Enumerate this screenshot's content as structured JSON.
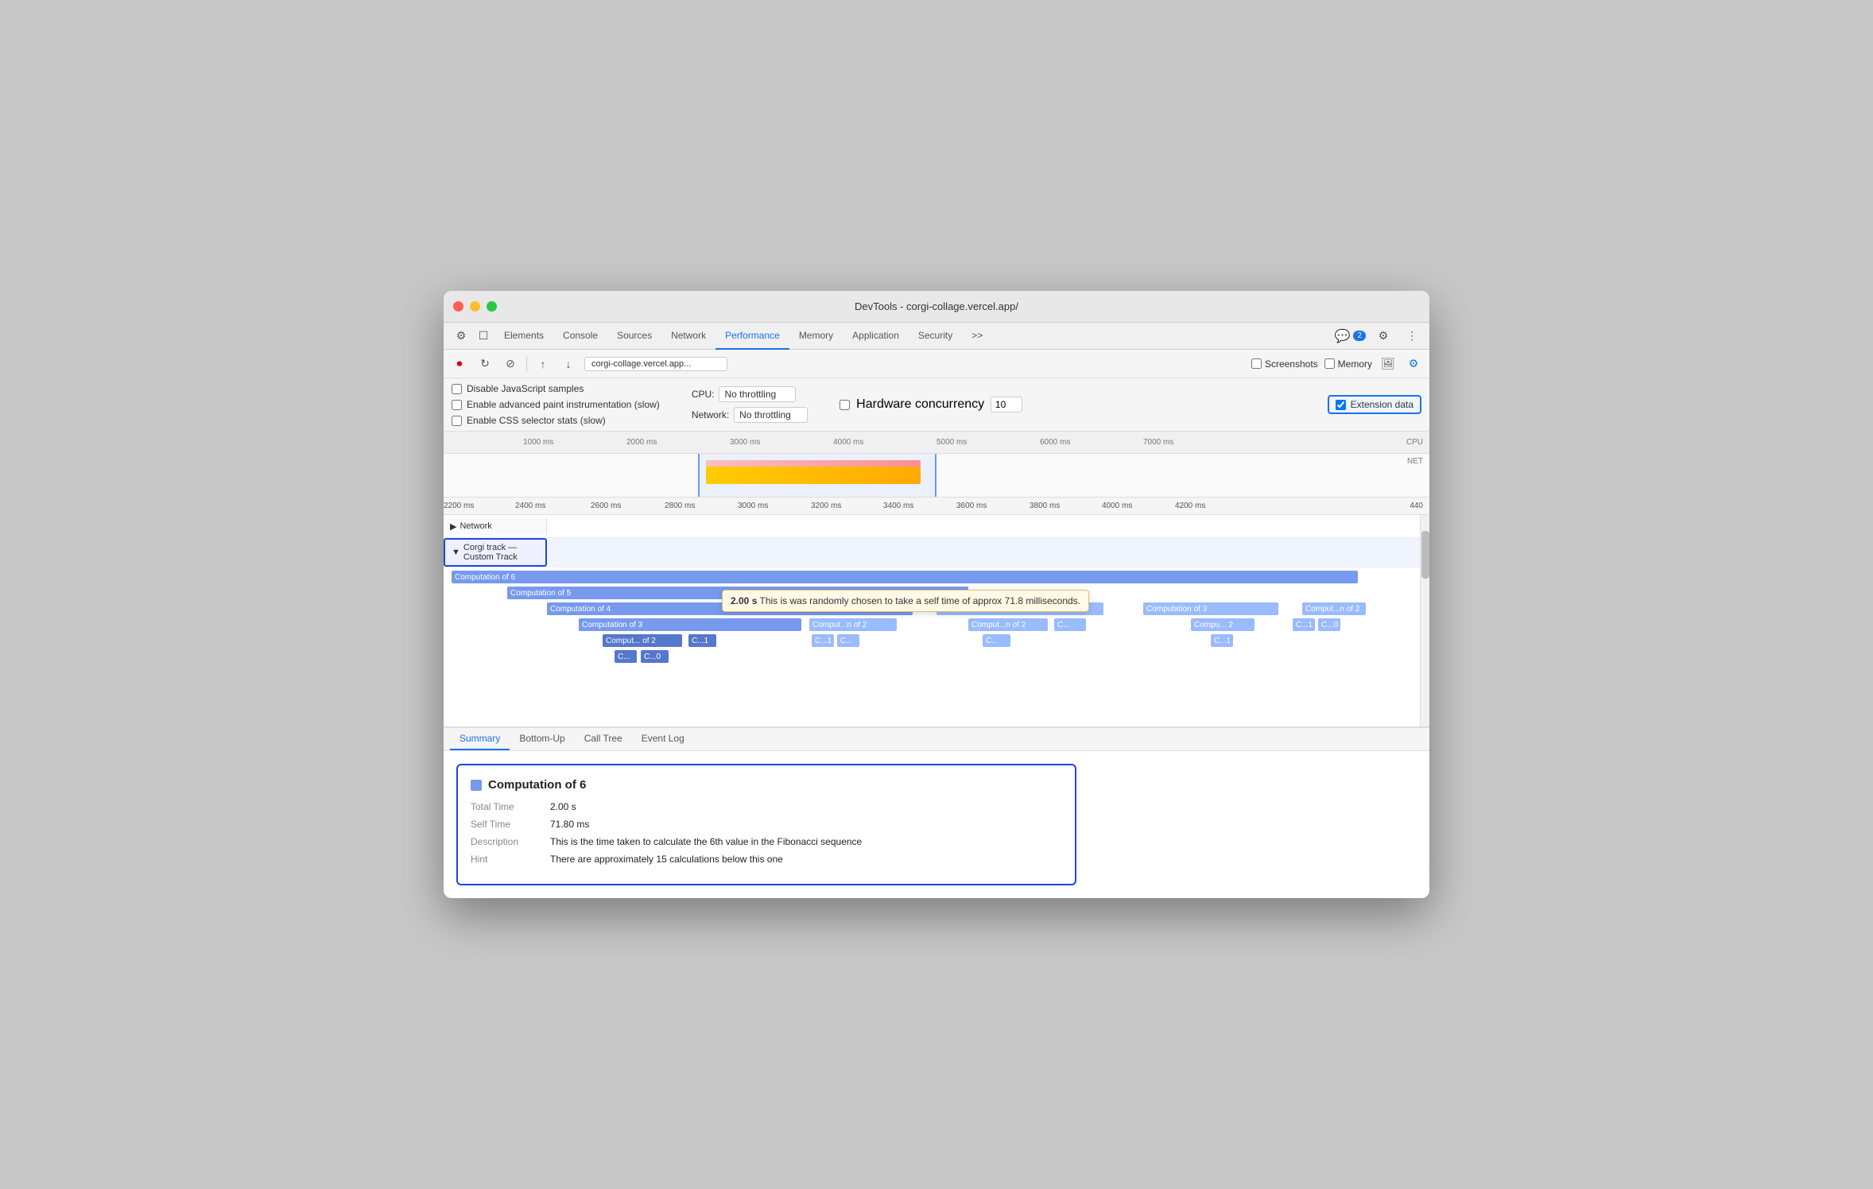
{
  "window": {
    "title": "DevTools - corgi-collage.vercel.app/"
  },
  "tabs": {
    "items": [
      "Elements",
      "Console",
      "Sources",
      "Network",
      "Performance",
      "Memory",
      "Application",
      "Security"
    ],
    "active": "Performance",
    "more": ">>",
    "badge": "2"
  },
  "toolbar2": {
    "url": "corgi-collage.vercel.app...",
    "screenshots_label": "Screenshots",
    "memory_label": "Memory"
  },
  "options": {
    "disable_js": "Disable JavaScript samples",
    "enable_paint": "Enable advanced paint instrumentation (slow)",
    "enable_css": "Enable CSS selector stats (slow)",
    "cpu_label": "CPU:",
    "cpu_value": "No throttling",
    "network_label": "Network:",
    "network_value": "No throttling",
    "hw_concurrency": "Hardware concurrency",
    "hw_value": "10",
    "extension_data": "Extension data"
  },
  "ruler_top": {
    "marks": [
      "1000 ms",
      "2000 ms",
      "3000 ms",
      "4000 ms",
      "5000 ms",
      "6000 ms",
      "7000 ms"
    ]
  },
  "ruler_detail": {
    "marks": [
      "2200 ms",
      "2400 ms",
      "2600 ms",
      "2800 ms",
      "3000 ms",
      "3200 ms",
      "3400 ms",
      "3600 ms",
      "3800 ms",
      "4000 ms",
      "4200 ms",
      "440"
    ]
  },
  "tracks": {
    "network_label": "Network",
    "custom_track_label": "Corgi track — Custom Track",
    "items": [
      {
        "label": "Computation of 6",
        "level": 0
      },
      {
        "label": "Computation of 5",
        "level": 1
      },
      {
        "label": "Computation of 4",
        "level": 2
      },
      {
        "label": "Computation of 3",
        "level": 3
      },
      {
        "label": "Computation of 3 (right)",
        "level": 2
      },
      {
        "label": "Computation of 3 (far right)",
        "level": 2
      },
      {
        "label": "Comput...n of 2",
        "level": 2
      },
      {
        "label": "Comput... of 2",
        "level": 3
      },
      {
        "label": "C...1",
        "level": 3
      },
      {
        "label": "C...0",
        "level": 3
      },
      {
        "label": "C...",
        "level": 4
      },
      {
        "label": "C...0",
        "level": 4
      }
    ]
  },
  "tooltip": {
    "time": "2.00 s",
    "text": "This is was randomly chosen to take a self time of approx 71.8 milliseconds."
  },
  "bottom_tabs": [
    "Summary",
    "Bottom-Up",
    "Call Tree",
    "Event Log"
  ],
  "bottom_tab_active": "Summary",
  "summary": {
    "title": "Computation of 6",
    "total_time_label": "Total Time",
    "total_time_value": "2.00 s",
    "self_time_label": "Self Time",
    "self_time_value": "71.80 ms",
    "description_label": "Description",
    "description_value": "This is the time taken to calculate the 6th value in the Fibonacci sequence",
    "hint_label": "Hint",
    "hint_value": "There are approximately 15 calculations below this one"
  }
}
